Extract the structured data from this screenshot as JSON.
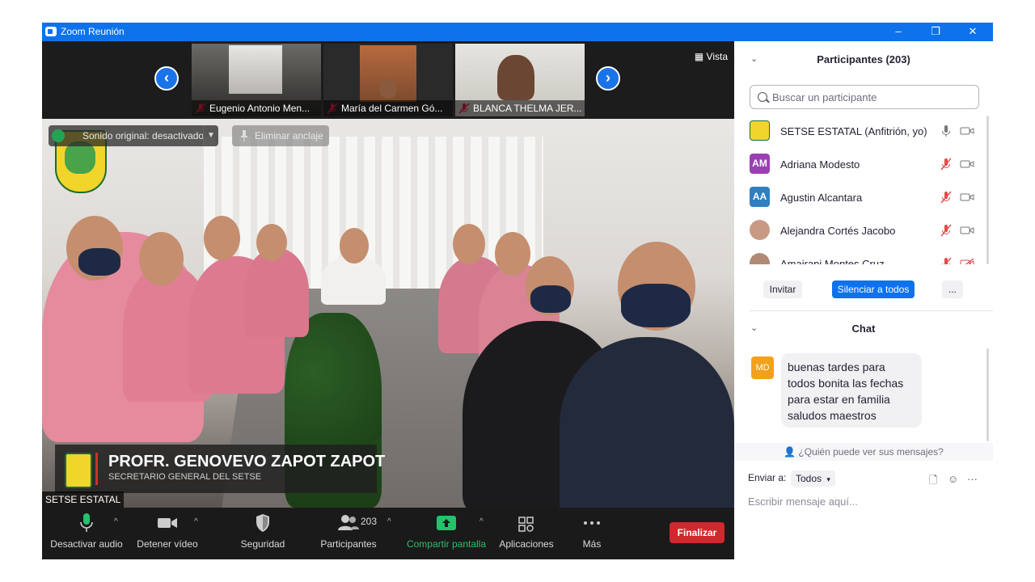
{
  "window": {
    "title": "Zoom Reunión",
    "controls": [
      "–",
      "❐",
      "✕"
    ]
  },
  "gallery": {
    "thumbnails": [
      {
        "name": "Eugenio Antonio Men..."
      },
      {
        "name": "María del Carmen Gó..."
      },
      {
        "name": "BLANCA THELMA JER..."
      }
    ],
    "view_label": "Vista"
  },
  "overlay": {
    "sound_label": "Sonido original: desactivado",
    "unpin_label": "Eliminar anclaje"
  },
  "speaker": {
    "name": "PROFR. GENOVEVO ZAPOT ZAPOT",
    "title": "SECRETARIO GENERAL DEL SETSE",
    "tag": "SETSE ESTATAL"
  },
  "toolbar": {
    "mute": "Desactivar audio",
    "video": "Detener vídeo",
    "security": "Seguridad",
    "participants": "Participantes",
    "participants_count": "203",
    "share": "Compartir pantalla",
    "apps": "Aplicaciones",
    "more": "Más",
    "end": "Finalizar"
  },
  "participants_panel": {
    "header": "Participantes (203)",
    "search_placeholder": "Buscar un participante",
    "people": [
      {
        "name": "SETSE ESTATAL (Anfitrión, yo)",
        "initials": "",
        "color": "#f2d52b"
      },
      {
        "name": "Adriana Modesto",
        "initials": "AM",
        "color": "#9b3fb5"
      },
      {
        "name": "Agustin Alcantara",
        "initials": "AA",
        "color": "#2f7fc1"
      },
      {
        "name": "Alejandra Cortés Jacobo",
        "initials": "",
        "color": "#c89a84"
      },
      {
        "name": "Amairani Montes Cruz",
        "initials": "",
        "color": "#b08a74"
      }
    ],
    "invite": "Invitar",
    "mute_all": "Silenciar a todos",
    "more": "..."
  },
  "chat": {
    "header": "Chat",
    "messages": [
      {
        "initials": "MD",
        "line1": "buenas tardes para",
        "line2": "todos bonita las fechas",
        "line3": "para estar en familia",
        "line4": "saludos maestros"
      }
    ],
    "who_can_see": "¿Quién puede ver sus mensajes?",
    "send_to_label": "Enviar a:",
    "send_to_value": "Todos",
    "compose_placeholder": "Escribir mensaje aquí..."
  }
}
